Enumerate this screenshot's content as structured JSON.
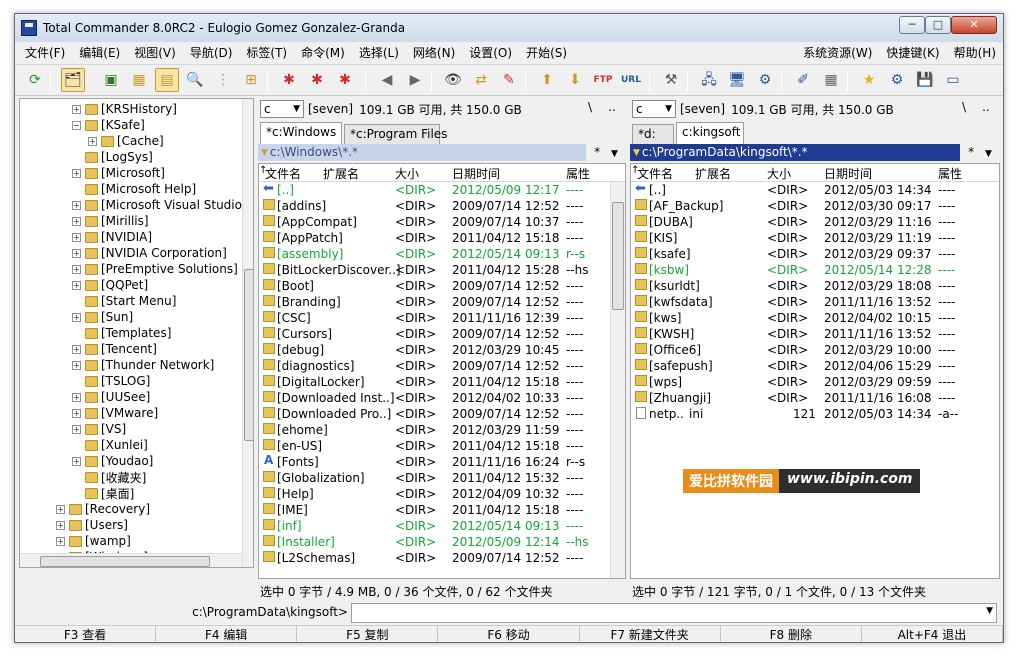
{
  "window": {
    "title": "Total Commander 8.0RC2 - Eulogio Gomez Gonzalez-Granda",
    "min": "─",
    "max": "□",
    "close": "✕"
  },
  "menu": {
    "left": [
      "文件(F)",
      "编辑(E)",
      "视图(V)",
      "导航(D)",
      "标签(T)",
      "命令(M)",
      "选择(L)",
      "网络(N)",
      "设置(O)",
      "开始(S)"
    ],
    "right": [
      "系统资源(W)",
      "快捷键(K)",
      "帮助(H)"
    ]
  },
  "toolbar": {
    "buttons": [
      {
        "name": "refresh-icon",
        "glyph": "⟳",
        "color": "#1e9e2a"
      },
      {
        "name": "tree-view-icon",
        "glyph": "🗂",
        "color": "#333",
        "active": true
      },
      {
        "name": "thumbnail-icon",
        "glyph": "▣",
        "color": "#2c7a2c"
      },
      {
        "name": "brief-view-icon",
        "glyph": "▦",
        "color": "#c79b2d"
      },
      {
        "name": "full-view-icon",
        "glyph": "▤",
        "color": "#c79b2d",
        "active": true
      },
      {
        "name": "quick-view-icon",
        "glyph": "🔍",
        "color": "#2c5aa0"
      },
      {
        "name": "tree-icon",
        "glyph": "⋮",
        "color": "#c79b2d"
      },
      {
        "name": "branch-icon",
        "glyph": "⊞",
        "color": "#c79b2d"
      },
      {
        "name": "select-plus-icon",
        "glyph": "✱",
        "color": "#d42b2b"
      },
      {
        "name": "select-minus-icon",
        "glyph": "✱",
        "color": "#d42b2b"
      },
      {
        "name": "select-invert-icon",
        "glyph": "✱",
        "color": "#d42b2b"
      },
      {
        "name": "back-icon",
        "glyph": "◀",
        "color": "#666"
      },
      {
        "name": "forward-icon",
        "glyph": "▶",
        "color": "#666"
      },
      {
        "name": "find-icon",
        "glyph": "👁",
        "color": "#333"
      },
      {
        "name": "sync-icon",
        "glyph": "⇄",
        "color": "#c79b2d"
      },
      {
        "name": "multi-rename-icon",
        "glyph": "✎",
        "color": "#c33"
      },
      {
        "name": "pack-icon",
        "glyph": "⬆",
        "color": "#c79b2d"
      },
      {
        "name": "unpack-icon",
        "glyph": "⬇",
        "color": "#c79b2d"
      },
      {
        "name": "ftp-icon",
        "glyph": "FTP",
        "color": "#c33"
      },
      {
        "name": "url-icon",
        "glyph": "URL",
        "color": "#2c5aa0"
      },
      {
        "name": "hammer-icon",
        "glyph": "⚒",
        "color": "#555"
      },
      {
        "name": "network-icon",
        "glyph": "🖧",
        "color": "#2c5aa0"
      },
      {
        "name": "desktop-icon",
        "glyph": "🖥",
        "color": "#2c5aa0"
      },
      {
        "name": "settings-icon",
        "glyph": "⚙",
        "color": "#2c5aa0"
      },
      {
        "name": "edit-note-icon",
        "glyph": "✐",
        "color": "#2c5aa0"
      },
      {
        "name": "calculator-icon",
        "glyph": "▦",
        "color": "#666"
      },
      {
        "name": "favorites-icon",
        "glyph": "★",
        "color": "#e7b416"
      },
      {
        "name": "control-panel-icon",
        "glyph": "⚙",
        "color": "#2c5aa0"
      },
      {
        "name": "save-icon",
        "glyph": "💾",
        "color": "#2c5aa0"
      },
      {
        "name": "window-icon",
        "glyph": "▭",
        "color": "#2c5aa0"
      }
    ]
  },
  "tree": {
    "items": [
      {
        "label": "[KRSHistory]",
        "lvl": 1,
        "exp": "+"
      },
      {
        "label": "[KSafe]",
        "lvl": 1,
        "exp": "−"
      },
      {
        "label": "[Cache]",
        "lvl": 2,
        "exp": "+"
      },
      {
        "label": "[LogSys]",
        "lvl": 1,
        "exp": ""
      },
      {
        "label": "[Microsoft]",
        "lvl": 1,
        "exp": "+"
      },
      {
        "label": "[Microsoft Help]",
        "lvl": 1,
        "exp": ""
      },
      {
        "label": "[Microsoft Visual Studio]",
        "lvl": 1,
        "exp": "+"
      },
      {
        "label": "[Mirillis]",
        "lvl": 1,
        "exp": "+"
      },
      {
        "label": "[NVIDIA]",
        "lvl": 1,
        "exp": "+"
      },
      {
        "label": "[NVIDIA Corporation]",
        "lvl": 1,
        "exp": "+"
      },
      {
        "label": "[PreEmptive Solutions]",
        "lvl": 1,
        "exp": "+"
      },
      {
        "label": "[QQPet]",
        "lvl": 1,
        "exp": "+"
      },
      {
        "label": "[Start Menu]",
        "lvl": 1,
        "exp": ""
      },
      {
        "label": "[Sun]",
        "lvl": 1,
        "exp": "+"
      },
      {
        "label": "[Templates]",
        "lvl": 1,
        "exp": ""
      },
      {
        "label": "[Tencent]",
        "lvl": 1,
        "exp": "+"
      },
      {
        "label": "[Thunder Network]",
        "lvl": 1,
        "exp": "+"
      },
      {
        "label": "[TSLOG]",
        "lvl": 1,
        "exp": ""
      },
      {
        "label": "[UUSee]",
        "lvl": 1,
        "exp": "+"
      },
      {
        "label": "[VMware]",
        "lvl": 1,
        "exp": "+"
      },
      {
        "label": "[VS]",
        "lvl": 1,
        "exp": "+"
      },
      {
        "label": "[Xunlei]",
        "lvl": 1,
        "exp": ""
      },
      {
        "label": "[Youdao]",
        "lvl": 1,
        "exp": "+"
      },
      {
        "label": "[收藏夹]",
        "lvl": 1,
        "exp": ""
      },
      {
        "label": "[桌面]",
        "lvl": 1,
        "exp": ""
      },
      {
        "label": "[Recovery]",
        "lvl": 0,
        "exp": "+"
      },
      {
        "label": "[Users]",
        "lvl": 0,
        "exp": "+"
      },
      {
        "label": "[wamp]",
        "lvl": 0,
        "exp": "+"
      },
      {
        "label": "[Windows]",
        "lvl": 0,
        "exp": "+"
      }
    ]
  },
  "left": {
    "drive": "c",
    "volume": "[seven]",
    "space": "109.1 GB 可用, 共 150.0 GB",
    "root_btn": "\\",
    "up_btn": "..",
    "tabs": [
      "*c:Windows",
      "*c:Program Files"
    ],
    "path": "c:\\Windows\\*.*",
    "filter": "*",
    "headers": {
      "name": "文件名",
      "ext": "扩展名",
      "size": "大小",
      "date": "日期时间",
      "attr": "属性"
    },
    "rows": [
      {
        "name": "[..]",
        "size": "<DIR>",
        "date": "2012/05/09 12:17",
        "attr": "----",
        "icon": "up",
        "green": true
      },
      {
        "name": "[addins]",
        "size": "<DIR>",
        "date": "2009/07/14 12:52",
        "attr": "----"
      },
      {
        "name": "[AppCompat]",
        "size": "<DIR>",
        "date": "2009/07/14 10:37",
        "attr": "----"
      },
      {
        "name": "[AppPatch]",
        "size": "<DIR>",
        "date": "2011/04/12 15:18",
        "attr": "----"
      },
      {
        "name": "[assembly]",
        "size": "<DIR>",
        "date": "2012/05/14 09:13",
        "attr": "r--s",
        "green": true
      },
      {
        "name": "[BitLockerDiscover..]",
        "size": "<DIR>",
        "date": "2011/04/12 15:28",
        "attr": "--hs"
      },
      {
        "name": "[Boot]",
        "size": "<DIR>",
        "date": "2009/07/14 12:52",
        "attr": "----"
      },
      {
        "name": "[Branding]",
        "size": "<DIR>",
        "date": "2009/07/14 12:52",
        "attr": "----"
      },
      {
        "name": "[CSC]",
        "size": "<DIR>",
        "date": "2011/11/16 12:39",
        "attr": "----"
      },
      {
        "name": "[Cursors]",
        "size": "<DIR>",
        "date": "2009/07/14 12:52",
        "attr": "----"
      },
      {
        "name": "[debug]",
        "size": "<DIR>",
        "date": "2012/03/29 10:45",
        "attr": "----"
      },
      {
        "name": "[diagnostics]",
        "size": "<DIR>",
        "date": "2009/07/14 12:52",
        "attr": "----"
      },
      {
        "name": "[DigitalLocker]",
        "size": "<DIR>",
        "date": "2011/04/12 15:18",
        "attr": "----"
      },
      {
        "name": "[Downloaded Inst..]",
        "size": "<DIR>",
        "date": "2012/04/02 10:33",
        "attr": "----"
      },
      {
        "name": "[Downloaded Pro..]",
        "size": "<DIR>",
        "date": "2009/07/14 12:52",
        "attr": "----"
      },
      {
        "name": "[ehome]",
        "size": "<DIR>",
        "date": "2012/03/29 11:59",
        "attr": "----"
      },
      {
        "name": "[en-US]",
        "size": "<DIR>",
        "date": "2011/04/12 15:18",
        "attr": "----"
      },
      {
        "name": "[Fonts]",
        "size": "<DIR>",
        "date": "2011/11/16 16:24",
        "attr": "r--s",
        "icon": "font"
      },
      {
        "name": "[Globalization]",
        "size": "<DIR>",
        "date": "2011/04/12 15:32",
        "attr": "----"
      },
      {
        "name": "[Help]",
        "size": "<DIR>",
        "date": "2012/04/09 10:32",
        "attr": "----"
      },
      {
        "name": "[IME]",
        "size": "<DIR>",
        "date": "2011/04/12 15:18",
        "attr": "----"
      },
      {
        "name": "[inf]",
        "size": "<DIR>",
        "date": "2012/05/14 09:13",
        "attr": "----",
        "green": true
      },
      {
        "name": "[Installer]",
        "size": "<DIR>",
        "date": "2012/05/09 12:14",
        "attr": "--hs",
        "green": true
      },
      {
        "name": "[L2Schemas]",
        "size": "<DIR>",
        "date": "2009/07/14 12:52",
        "attr": "----"
      }
    ],
    "status": "选中 0 字节 / 4.9 MB, 0 / 36 个文件, 0 / 62 个文件夹"
  },
  "right": {
    "drive": "c",
    "volume": "[seven]",
    "space": "109.1 GB 可用, 共 150.0 GB",
    "root_btn": "\\",
    "up_btn": "..",
    "tabs": [
      "*d:",
      "c:kingsoft"
    ],
    "path": "c:\\ProgramData\\kingsoft\\*.*",
    "filter": "*",
    "headers": {
      "name": "文件名",
      "ext": "扩展名",
      "size": "大小",
      "date": "日期时间",
      "attr": "属性"
    },
    "rows": [
      {
        "name": "[..]",
        "size": "<DIR>",
        "date": "2012/05/03 14:34",
        "attr": "----",
        "icon": "up"
      },
      {
        "name": "[AF_Backup]",
        "size": "<DIR>",
        "date": "2012/03/30 09:17",
        "attr": "----"
      },
      {
        "name": "[DUBA]",
        "size": "<DIR>",
        "date": "2012/03/29 11:16",
        "attr": "----"
      },
      {
        "name": "[KIS]",
        "size": "<DIR>",
        "date": "2012/03/29 11:19",
        "attr": "----"
      },
      {
        "name": "[ksafe]",
        "size": "<DIR>",
        "date": "2012/03/29 09:37",
        "attr": "----"
      },
      {
        "name": "[ksbw]",
        "size": "<DIR>",
        "date": "2012/05/14 12:28",
        "attr": "----",
        "green": true
      },
      {
        "name": "[ksurldt]",
        "size": "<DIR>",
        "date": "2012/03/29 18:08",
        "attr": "----"
      },
      {
        "name": "[kwfsdata]",
        "size": "<DIR>",
        "date": "2011/11/16 13:52",
        "attr": "----"
      },
      {
        "name": "[kws]",
        "size": "<DIR>",
        "date": "2012/04/02 10:15",
        "attr": "----"
      },
      {
        "name": "[KWSH]",
        "size": "<DIR>",
        "date": "2011/11/16 13:52",
        "attr": "----"
      },
      {
        "name": "[Office6]",
        "size": "<DIR>",
        "date": "2012/03/29 10:00",
        "attr": "----"
      },
      {
        "name": "[safepush]",
        "size": "<DIR>",
        "date": "2012/04/06 15:29",
        "attr": "----"
      },
      {
        "name": "[wps]",
        "size": "<DIR>",
        "date": "2012/03/29 09:59",
        "attr": "----"
      },
      {
        "name": "[Zhuangji]",
        "size": "<DIR>",
        "date": "2011/11/16 16:08",
        "attr": "----"
      },
      {
        "name": "netp..",
        "ext": "ini",
        "size": "121",
        "date": "2012/05/03 14:34",
        "attr": "-a--",
        "icon": "file"
      }
    ],
    "status": "选中 0 字节 / 121 字节, 0 / 1 个文件, 0 / 13 个文件夹"
  },
  "cmdline": {
    "label": "c:\\ProgramData\\kingsoft>",
    "value": ""
  },
  "fkeys": [
    "F3 查看",
    "F4 编辑",
    "F5 复制",
    "F6 移动",
    "F7 新建文件夹",
    "F8 删除",
    "Alt+F4 退出"
  ],
  "watermark": {
    "left": "爱比拼软件园",
    "right": "www.ibipin.com"
  },
  "colors": {
    "active_path_bg": "#1f3b92",
    "inactive_path_bg": "#c8d4e9",
    "green_text": "#11a833",
    "link_blue": "#2f63c5"
  }
}
